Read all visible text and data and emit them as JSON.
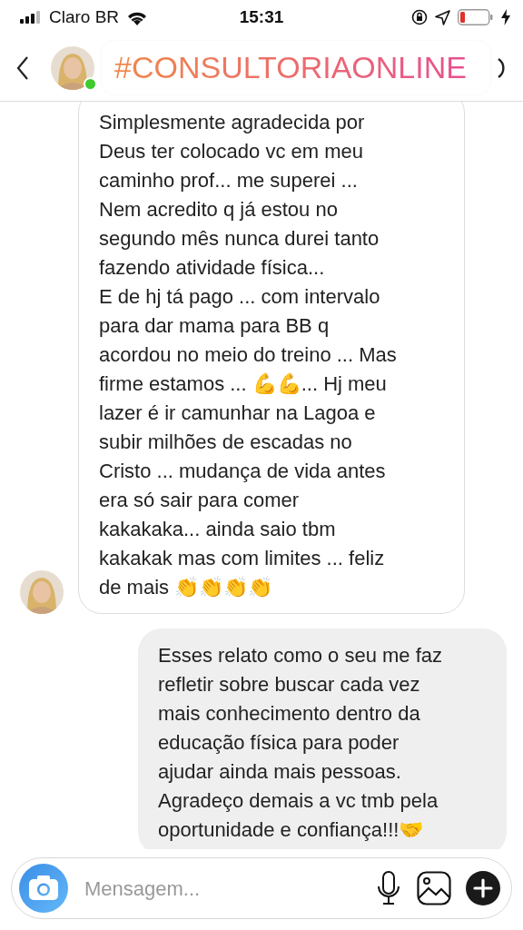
{
  "status_bar": {
    "carrier": "Claro BR",
    "time": "15:31"
  },
  "header": {
    "sticker": "#CONSULTORIAONLINE",
    "online": true
  },
  "messages": [
    {
      "kind": "received",
      "text": "Simplesmente agradecida por\nDeus ter colocado vc em meu\ncaminho prof... me superei ...\nNem acredito q já estou no\nsegundo mês nunca durei tanto\nfazendo atividade física...\nE de hj tá pago ... com intervalo\npara dar mama para BB q\nacordou no meio do treino ... Mas\nfirme estamos ... 💪💪... Hj meu\nlazer é ir camunhar na Lagoa e\nsubir milhões de escadas no\nCristo ... mudança de vida antes\nera só sair para comer\nkakakaka... ainda saio tbm\nkakakak mas com limites ... feliz\nde mais 👏👏👏👏"
    },
    {
      "kind": "sent",
      "text": "Esses relato como o seu me faz\nrefletir sobre buscar cada vez\nmais conhecimento dentro da\neducação física para poder\najudar ainda mais pessoas.\nAgradeço demais a vc tmb pela\noportunidade e confiança!!!🤝"
    }
  ],
  "composer": {
    "placeholder": "Mensagem..."
  }
}
